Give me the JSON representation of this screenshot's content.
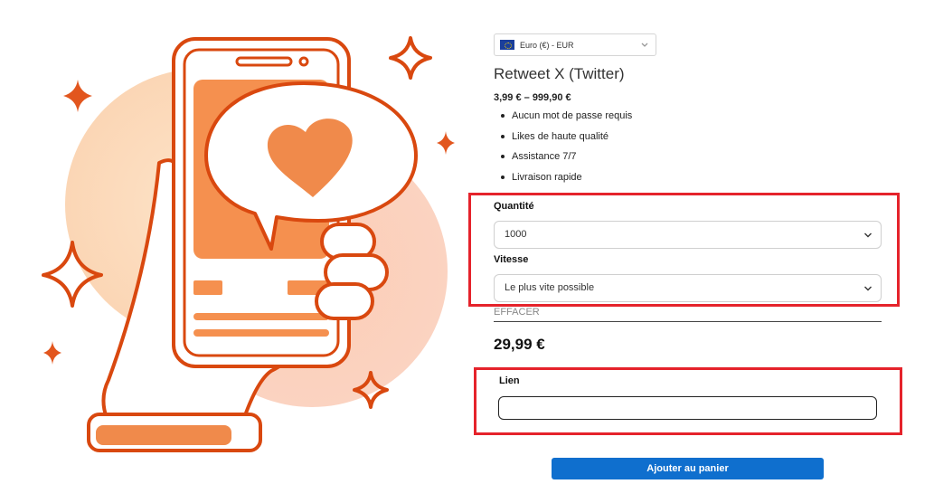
{
  "currency": {
    "label": "Euro (€) - EUR",
    "icon": "eu-flag-icon"
  },
  "product": {
    "title": "Retweet X (Twitter)",
    "price_range": "3,99 € – 999,90 €",
    "features": [
      "Aucun mot de passe requis",
      "Likes de haute qualité",
      "Assistance 7/7",
      "Livraison rapide"
    ]
  },
  "options": {
    "quantity_label": "Quantité",
    "quantity_value": "1000",
    "speed_label": "Vitesse",
    "speed_value": "Le plus vite possible",
    "clear_label": "EFFACER"
  },
  "total_price": "29,99 €",
  "link_field": {
    "label": "Lien",
    "value": ""
  },
  "cart_button": "Ajouter au panier",
  "colors": {
    "accent_orange": "#f08a4b",
    "dark_orange": "#d9480f",
    "highlight_red": "#e5232b",
    "button_blue": "#0f6fce"
  }
}
